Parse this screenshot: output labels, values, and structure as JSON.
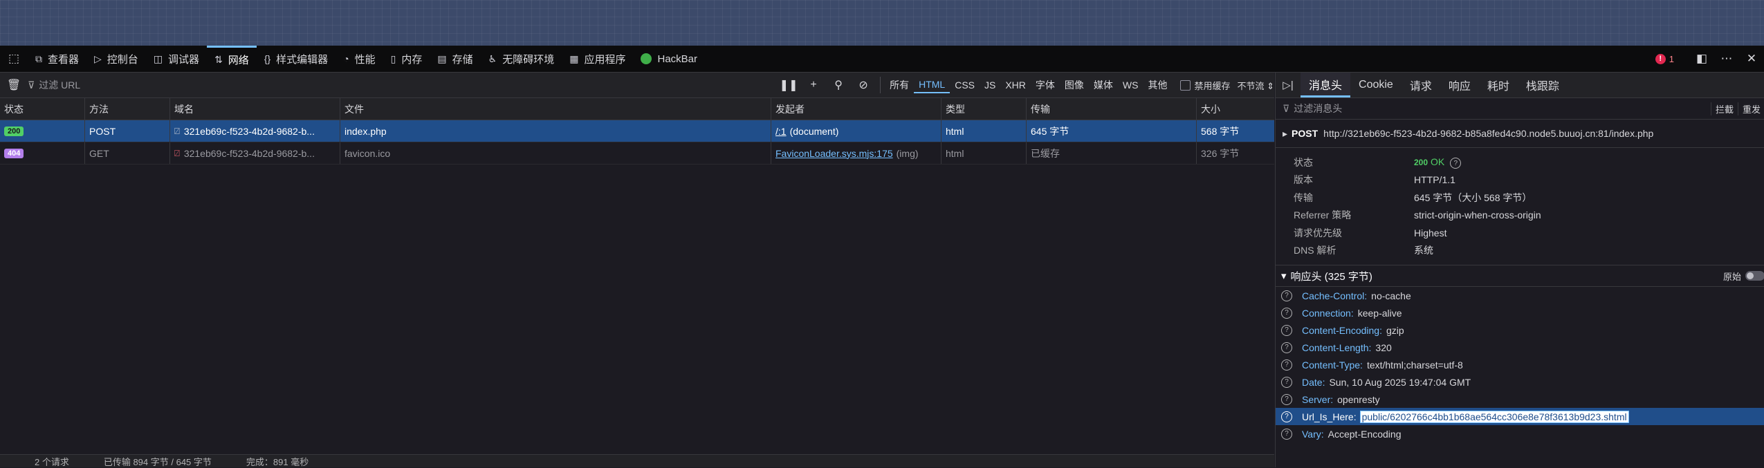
{
  "toolbar": {
    "tabs": [
      {
        "icon": "⧉",
        "label": "查看器"
      },
      {
        "icon": "▷",
        "label": "控制台"
      },
      {
        "icon": "◫",
        "label": "调试器"
      },
      {
        "icon": "⇅",
        "label": "网络"
      },
      {
        "icon": "{}",
        "label": "样式编辑器"
      },
      {
        "icon": "◔",
        "label": "性能"
      },
      {
        "icon": "▯",
        "label": "内存"
      },
      {
        "icon": "▤",
        "label": "存储"
      },
      {
        "icon": "♿",
        "label": "无障碍环境"
      },
      {
        "icon": "▦",
        "label": "应用程序"
      },
      {
        "icon": "",
        "label": "HackBar"
      }
    ],
    "error_count": "1"
  },
  "network": {
    "filter_placeholder": "过滤 URL",
    "type_filters": [
      "所有",
      "HTML",
      "CSS",
      "JS",
      "XHR",
      "字体",
      "图像",
      "媒体",
      "WS",
      "其他"
    ],
    "disable_cache_label": "禁用缓存",
    "throttle_label": "不节流 ⇕",
    "columns": [
      "状态",
      "方法",
      "域名",
      "文件",
      "发起者",
      "类型",
      "传输",
      "大小"
    ],
    "rows": [
      {
        "status": "200",
        "method": "POST",
        "domain": "321eb69c-f523-4b2d-9682-b...",
        "file": "index.php",
        "initiator_link": "/:1",
        "initiator_note": "(document)",
        "type": "html",
        "transferred": "645 字节",
        "size": "568 字节"
      },
      {
        "status": "404",
        "method": "GET",
        "domain": "321eb69c-f523-4b2d-9682-b...",
        "file": "favicon.ico",
        "initiator_link": "FaviconLoader.sys.mjs:175",
        "initiator_note": "(img)",
        "type": "html",
        "transferred": "已缓存",
        "size": "326 字节"
      }
    ],
    "statusbar": [
      "2 个请求",
      "已传输 894 字节 / 645 字节",
      "完成：891 毫秒"
    ]
  },
  "details": {
    "tabs": [
      "消息头",
      "Cookie",
      "请求",
      "响应",
      "耗时",
      "栈跟踪"
    ],
    "filter_placeholder": "过滤消息头",
    "block_label": "拦截",
    "resend_label": "重发",
    "request_method": "POST",
    "request_url": "http://321eb69c-f523-4b2d-9682-b85a8fed4c90.node5.buuoj.cn:81/index.php",
    "summary": {
      "status_label": "状态",
      "status_code": "200",
      "status_text": "OK",
      "version_label": "版本",
      "version": "HTTP/1.1",
      "transfer_label": "传输",
      "transfer": "645 字节（大小 568 字节）",
      "referrer_label": "Referrer 策略",
      "referrer": "strict-origin-when-cross-origin",
      "priority_label": "请求优先级",
      "priority": "Highest",
      "dns_label": "DNS 解析",
      "dns": "系统"
    },
    "response_headers_title": "响应头 (325 字节)",
    "raw_label": "原始",
    "response_headers": [
      {
        "name": "Cache-Control:",
        "value": "no-cache"
      },
      {
        "name": "Connection:",
        "value": "keep-alive"
      },
      {
        "name": "Content-Encoding:",
        "value": "gzip"
      },
      {
        "name": "Content-Length:",
        "value": "320"
      },
      {
        "name": "Content-Type:",
        "value": "text/html;charset=utf-8"
      },
      {
        "name": "Date:",
        "value": "Sun, 10 Aug 2025 19:47:04 GMT"
      },
      {
        "name": "Server:",
        "value": "openresty"
      },
      {
        "name": "Url_Is_Here:",
        "value": "public/6202766c4bb1b68ae564cc306e8e78f3613b9d23.shtml"
      },
      {
        "name": "Vary:",
        "value": "Accept-Encoding"
      }
    ]
  }
}
